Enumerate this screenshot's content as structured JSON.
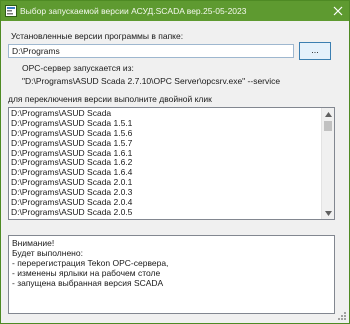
{
  "window": {
    "title": "Выбор запускаемой версии АСУД.SCADA вер.25-05-2023",
    "close_icon": "close-x-icon",
    "app_icon": "app-icon"
  },
  "form": {
    "installed_label": "Установленные версии программы в папке:",
    "folder_value": "D:\\Programs",
    "browse_label": "...",
    "opc_label": "OPC-сервер запускается из:",
    "opc_command": "\"D:\\Programs\\ASUD Scada 2.7.10\\OPC Server\\opcsrv.exe\" --service",
    "switch_label": "для переключения версии выполните двойной клик"
  },
  "versions": [
    "D:\\Programs\\ASUD Scada",
    "D:\\Programs\\ASUD Scada 1.5.1",
    "D:\\Programs\\ASUD Scada 1.5.6",
    "D:\\Programs\\ASUD Scada 1.5.7",
    "D:\\Programs\\ASUD Scada 1.6.1",
    "D:\\Programs\\ASUD Scada 1.6.2",
    "D:\\Programs\\ASUD Scada 1.6.4",
    "D:\\Programs\\ASUD Scada 2.0.1",
    "D:\\Programs\\ASUD Scada 2.0.3",
    "D:\\Programs\\ASUD Scada 2.0.4",
    "D:\\Programs\\ASUD Scada 2.0.5"
  ],
  "memo": [
    "Внимание!",
    "Будет выполнено:",
    "- перерегистрация Tekon OPC-сервера,",
    "- изменены ярлыки на рабочем столе",
    "- запущена выбранная версия SCADA"
  ],
  "colors": {
    "titlebar": "#5e9a30",
    "window_bg": "#f0f0f0",
    "button_bg": "#e5f1fb",
    "button_border": "#3c7fb1"
  }
}
